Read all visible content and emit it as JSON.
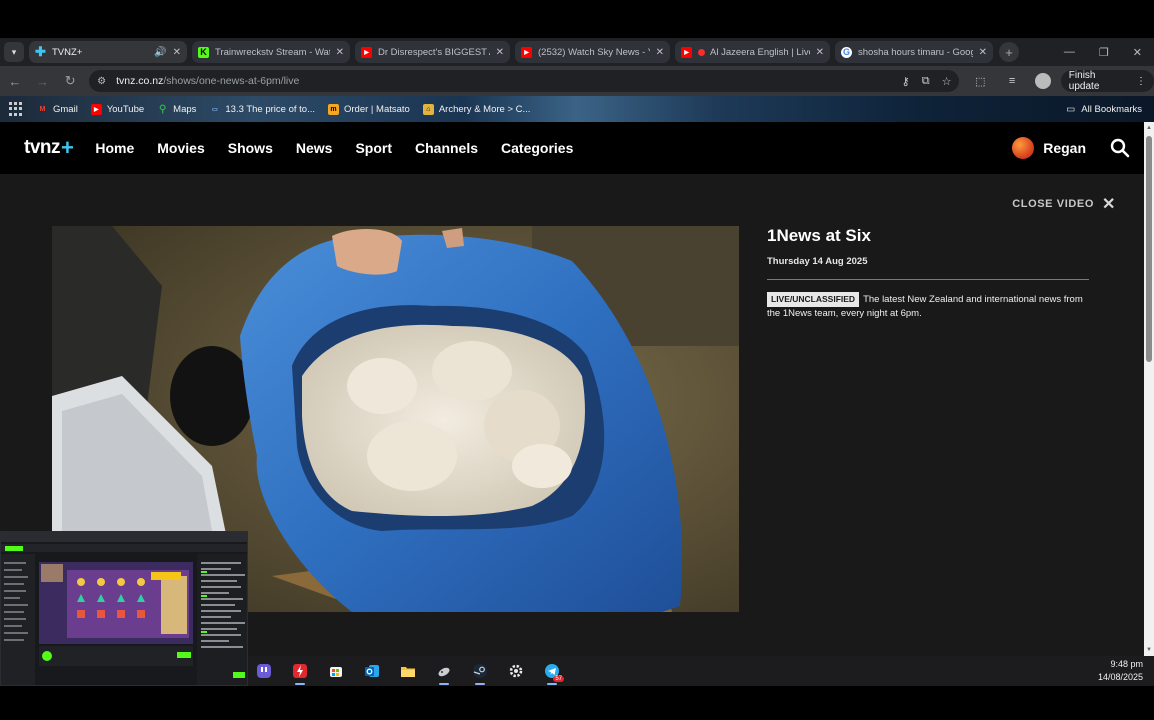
{
  "browser": {
    "tabs": [
      {
        "title": "TVNZ+",
        "active": true,
        "favicon": "tvnz-plus-icon",
        "color": "#3ec6f1",
        "has_audio": true
      },
      {
        "title": "Trainwreckstv Stream - Watc",
        "active": false,
        "favicon": "kick-icon",
        "color": "#53fc18"
      },
      {
        "title": "Dr Disrespect's BIGGEST Al",
        "active": false,
        "favicon": "youtube-icon",
        "color": "#ff0000"
      },
      {
        "title": "(2532) Watch Sky News - Yo",
        "active": false,
        "favicon": "youtube-icon",
        "color": "#ff0000"
      },
      {
        "title": "Al Jazeera English | Live",
        "active": false,
        "favicon": "youtube-icon",
        "color": "#ff0000",
        "recording": true
      },
      {
        "title": "shosha hours timaru - Goog",
        "active": false,
        "favicon": "google-icon",
        "color": "#4285f4"
      }
    ],
    "url_host": "tvnz.co.nz",
    "url_path": "/shows/one-news-at-6pm/live",
    "finish_update_label": "Finish update",
    "bookmarks": [
      {
        "label": "Gmail",
        "icon": "gmail-icon",
        "color": "#ea4335"
      },
      {
        "label": "YouTube",
        "icon": "youtube-icon",
        "color": "#ff0000"
      },
      {
        "label": "Maps",
        "icon": "maps-icon",
        "color": "#34a853"
      },
      {
        "label": "13.3 The price of to...",
        "icon": "page-icon",
        "color": "#8ab4f8"
      },
      {
        "label": "Order | Matsato",
        "icon": "matsato-icon",
        "color": "#f5a623"
      },
      {
        "label": "Archery & More > C...",
        "icon": "archery-icon",
        "color": "#e2b340"
      }
    ],
    "all_bookmarks_label": "All Bookmarks"
  },
  "site": {
    "logo_text": "tvnz",
    "logo_plus": "+",
    "nav": [
      "Home",
      "Movies",
      "Shows",
      "News",
      "Sport",
      "Channels",
      "Categories"
    ],
    "user_name": "Regan",
    "close_video_label": "CLOSE VIDEO",
    "show": {
      "title": "1News at Six",
      "date": "Thursday 14 Aug 2025",
      "badge": "LIVE/UNCLASSIFIED",
      "description": "The latest New Zealand and international news from the 1News team, every night at 6pm."
    }
  },
  "taskbar": {
    "time": "9:48 pm",
    "date": "14/08/2025",
    "icons": [
      "twitch-icon",
      "power-app-icon",
      "store-icon",
      "outlook-icon",
      "file-explorer-icon",
      "gaming-icon",
      "steam-icon",
      "settings-icon",
      "telegram-icon"
    ],
    "telegram_badge": "57"
  }
}
